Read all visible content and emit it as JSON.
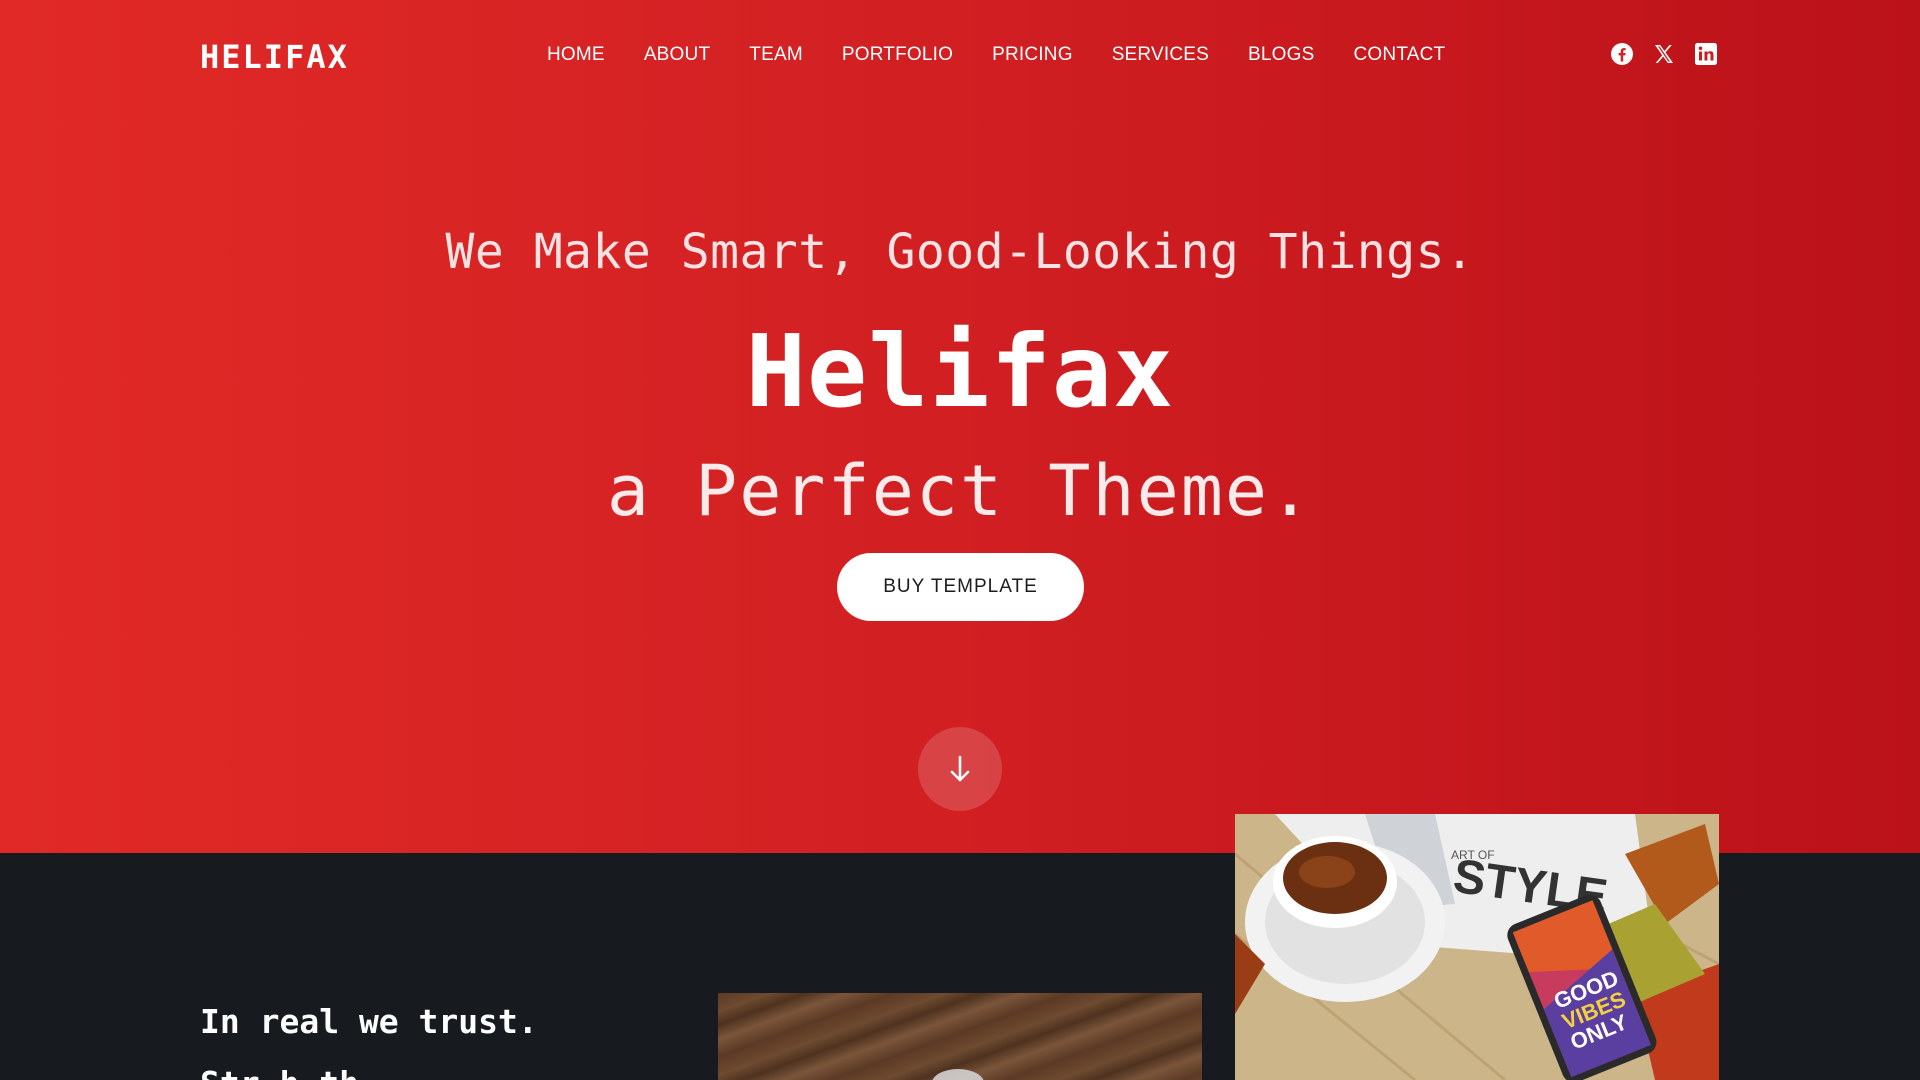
{
  "header": {
    "logo": "HELIFAX",
    "nav": [
      {
        "label": "HOME"
      },
      {
        "label": "ABOUT"
      },
      {
        "label": "TEAM"
      },
      {
        "label": "PORTFOLIO"
      },
      {
        "label": "PRICING"
      },
      {
        "label": "SERVICES"
      },
      {
        "label": "BLOGS"
      },
      {
        "label": "CONTACT"
      }
    ],
    "social": [
      "facebook-icon",
      "x-icon",
      "linkedin-icon"
    ]
  },
  "hero": {
    "tagline": "We Make Smart, Good-Looking Things.",
    "brand": "Helifax",
    "subtitle": "a Perfect Theme.",
    "cta_label": "BUY TEMPLATE",
    "scroll_icon": "arrow-down-icon",
    "gradient_start": "#e12a27",
    "gradient_end": "#bb1119"
  },
  "about": {
    "heading": "In real we trust.",
    "heading2": "Str               h  th",
    "background": "#171b20",
    "magazine_text": "STYLE",
    "magazine_small": "ART OF",
    "phone_case_text": [
      "GOOD",
      "VIBES",
      "ONLY"
    ]
  }
}
